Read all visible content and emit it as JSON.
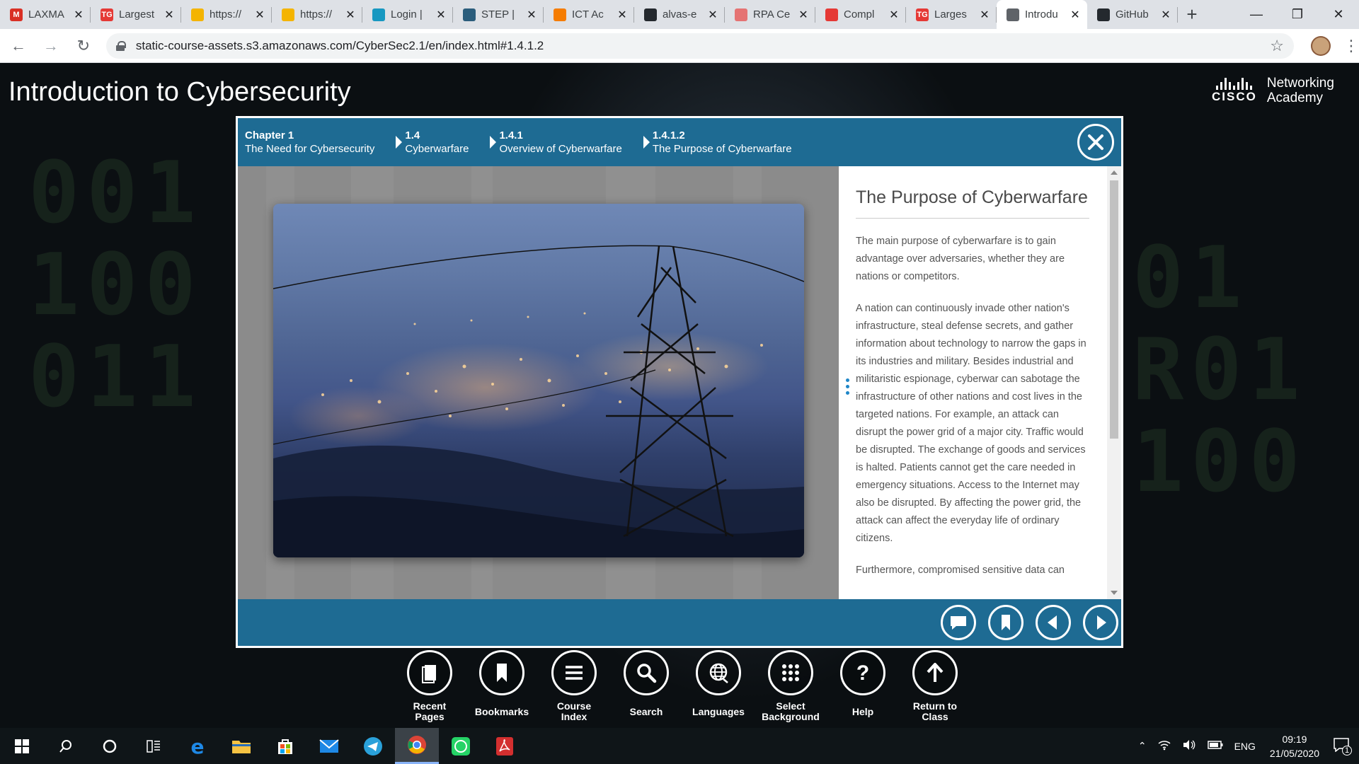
{
  "browser": {
    "tabs": [
      {
        "title": "LAXMA",
        "icon": "gmail-icon",
        "color": "#d93025",
        "glyph": "M"
      },
      {
        "title": "Largest",
        "icon": "tg-icon",
        "color": "#e53935",
        "glyph": "TG"
      },
      {
        "title": "https://",
        "icon": "site-icon",
        "color": "#f4b400",
        "glyph": ""
      },
      {
        "title": "https://",
        "icon": "site-icon",
        "color": "#f4b400",
        "glyph": ""
      },
      {
        "title": "Login |",
        "icon": "salesforce-icon",
        "color": "#1798c1",
        "glyph": ""
      },
      {
        "title": "STEP |",
        "icon": "step-icon",
        "color": "#2b5d7c",
        "glyph": ""
      },
      {
        "title": "ICT Ac",
        "icon": "ict-icon",
        "color": "#f57c00",
        "glyph": ""
      },
      {
        "title": "alvas-e",
        "icon": "github-icon",
        "color": "#24292e",
        "glyph": ""
      },
      {
        "title": "RPA Ce",
        "icon": "rpa-icon",
        "color": "#e57373",
        "glyph": ""
      },
      {
        "title": "Compl",
        "icon": "coursera-icon",
        "color": "#e53935",
        "glyph": ""
      },
      {
        "title": "Larges",
        "icon": "tg-icon",
        "color": "#e53935",
        "glyph": "TG"
      },
      {
        "title": "Introdu",
        "icon": "globe-icon",
        "color": "#5f6368",
        "glyph": "",
        "active": true
      },
      {
        "title": "GitHub",
        "icon": "github-icon",
        "color": "#24292e",
        "glyph": ""
      }
    ],
    "url": "static-course-assets.s3.amazonaws.com/CyberSec2.1/en/index.html#1.4.1.2"
  },
  "page": {
    "course_title": "Introduction to Cybersecurity",
    "brand_word": "CISCO",
    "brand_line1": "Networking",
    "brand_line2": "Academy"
  },
  "breadcrumbs": [
    {
      "num": "Chapter 1",
      "label": "The Need for Cybersecurity"
    },
    {
      "num": "1.4",
      "label": "Cyberwarfare"
    },
    {
      "num": "1.4.1",
      "label": "Overview of Cyberwarfare"
    },
    {
      "num": "1.4.1.2",
      "label": "The Purpose of Cyberwarfare"
    }
  ],
  "content": {
    "title": "The Purpose of Cyberwarfare",
    "paragraphs": [
      "The main purpose of cyberwarfare is to gain advantage over adversaries, whether they are nations or competitors.",
      "A nation can continuously invade other nation's infrastructure, steal defense secrets, and gather information about technology to narrow the gaps in its industries and military. Besides industrial and militaristic espionage, cyberwar can sabotage the infrastructure of other nations and cost lives in the targeted nations. For example, an attack can disrupt the power grid of a major city. Traffic would be disrupted. The exchange of goods and services is halted. Patients cannot get the care needed in emergency situations. Access to the Internet may also be disrupted. By affecting the power grid, the attack can affect the everyday life of ordinary citizens.",
      "Furthermore, compromised sensitive data can"
    ]
  },
  "modal_controls": [
    "comment-icon",
    "bookmark-icon",
    "previous-icon",
    "next-icon"
  ],
  "dock": [
    {
      "label": "Recent\nPages",
      "icon": "recent-pages-icon"
    },
    {
      "label": "Bookmarks",
      "icon": "bookmarks-icon"
    },
    {
      "label": "Course\nIndex",
      "icon": "course-index-icon"
    },
    {
      "label": "Search",
      "icon": "search-icon"
    },
    {
      "label": "Languages",
      "icon": "languages-icon"
    },
    {
      "label": "Select\nBackground",
      "icon": "select-background-icon"
    },
    {
      "label": "Help",
      "icon": "help-icon"
    },
    {
      "label": "Return to\nClass",
      "icon": "return-to-class-icon"
    }
  ],
  "taskbar": {
    "apps": [
      "windows-start-icon",
      "search-icon",
      "cortana-icon",
      "task-view-icon",
      "edge-icon",
      "file-explorer-icon",
      "store-icon",
      "mail-icon",
      "telegram-icon",
      "chrome-icon",
      "whatsapp-icon",
      "acrobat-icon"
    ],
    "language": "ENG",
    "time": "09:19",
    "date": "21/05/2020",
    "notification_count": "1"
  }
}
